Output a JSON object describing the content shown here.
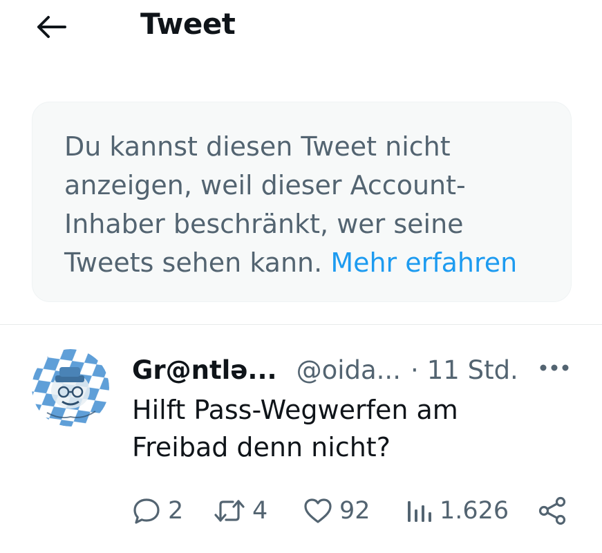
{
  "header": {
    "title": "Tweet",
    "back_icon": "arrow-left-icon"
  },
  "notice": {
    "message": "Du kannst diesen Tweet nicht anzeigen, weil dieser Account-Inhaber beschränkt, wer seine Tweets sehen kann.",
    "link_label": "Mehr erfahren"
  },
  "tweet": {
    "author_name": "Gr@ntlə...",
    "author_handle": "@oida...",
    "separator": "·",
    "time": "11 Std.",
    "text_line1": "Hilft Pass-Wegwerfen am",
    "text_line2": "Freibad denn nicht?",
    "more_icon": "more-horizontal-icon",
    "avatar_icon": "bavarian-diamond-avatar"
  },
  "actions": {
    "reply_count": "2",
    "retweet_count": "4",
    "like_count": "92",
    "view_count": "1.626"
  },
  "colors": {
    "text_primary": "#0f1419",
    "text_secondary": "#536471",
    "link": "#1d9bf0",
    "card_bg": "#f7f9f9",
    "avatar_blue": "#5f9fd8"
  }
}
